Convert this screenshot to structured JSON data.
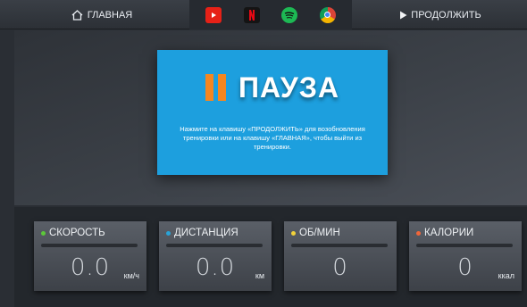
{
  "topbar": {
    "home_label": "ГЛАВНАЯ",
    "continue_label": "ПРОДОЛЖИТЬ",
    "apps": [
      {
        "name": "youtube-app-icon",
        "color": "#e62117"
      },
      {
        "name": "netflix-app-icon",
        "color": "#141414"
      },
      {
        "name": "spotify-app-icon",
        "color": "#1db954"
      },
      {
        "name": "chrome-app-icon",
        "color": "#f4b400"
      }
    ]
  },
  "dialog": {
    "title": "ПАУЗА",
    "message": "Нажмите на клавишу «ПРОДОЛЖИТЬ» для возобновления тренировки или на клавишу «ГЛАВНАЯ», чтобы выйти из тренировки.",
    "accent_color": "#1d9fde",
    "pause_color": "#f5861f"
  },
  "metrics": [
    {
      "label": "СКОРОСТЬ",
      "value": "0.0",
      "unit": "км/ч",
      "dot_color": "#5cc83a"
    },
    {
      "label": "ДИСТАНЦИЯ",
      "value": "0.0",
      "unit": "км",
      "dot_color": "#2aa3d6"
    },
    {
      "label": "ОБ/МИН",
      "value": "0",
      "unit": "",
      "dot_color": "#f2d23a"
    },
    {
      "label": "КАЛОРИИ",
      "value": "0",
      "unit": "ккал",
      "dot_color": "#f0663a"
    }
  ]
}
